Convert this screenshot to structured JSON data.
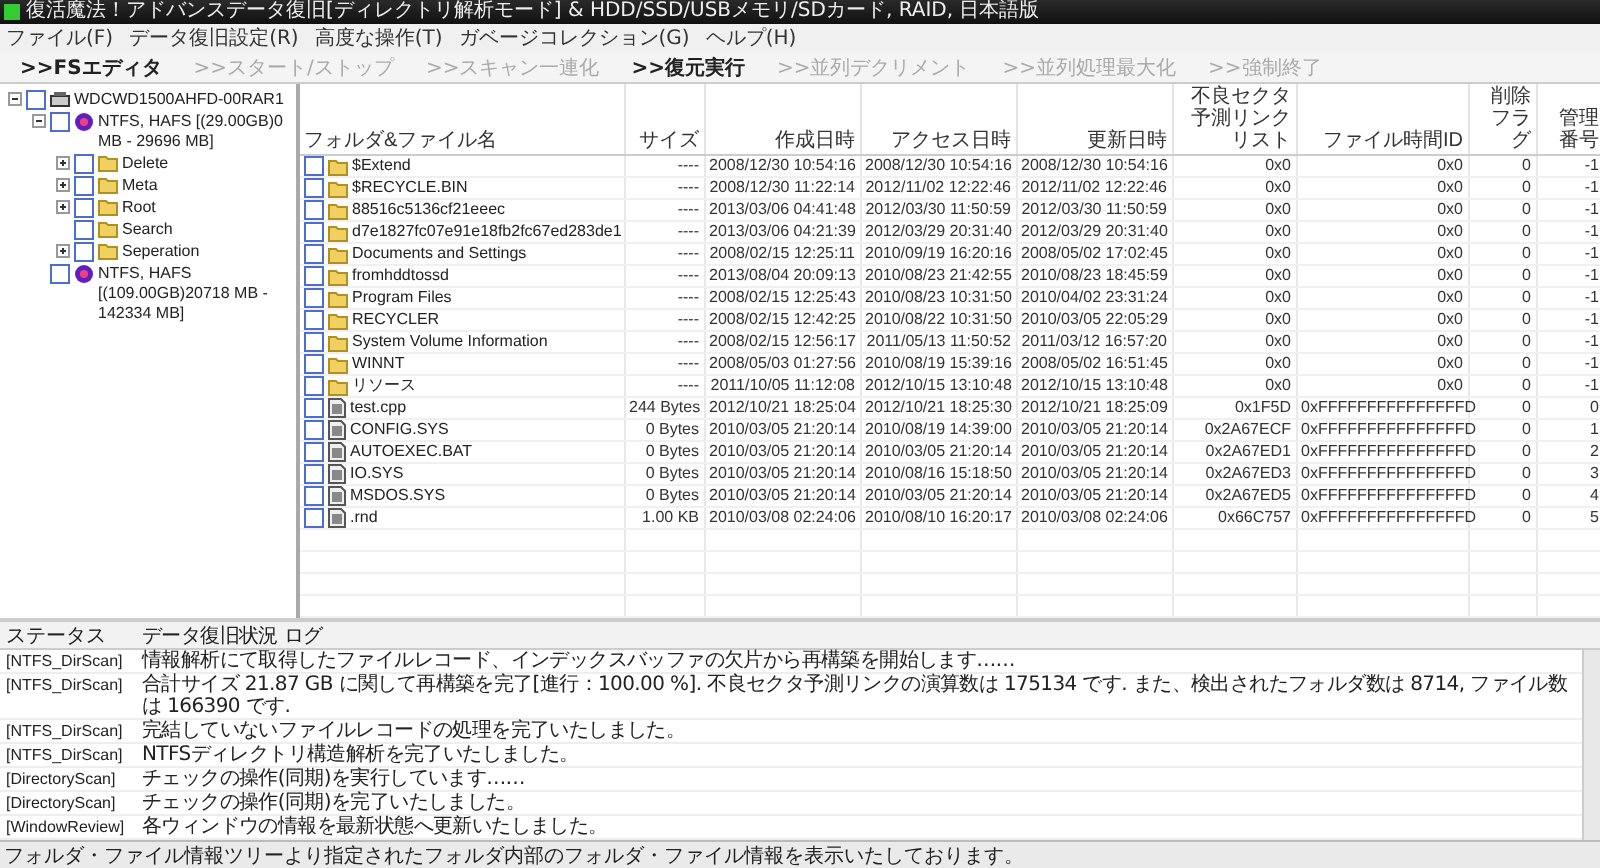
{
  "window": {
    "title": "復活魔法！アドバンスデータ復旧[ディレクトリ解析モード] & HDD/SSD/USBメモリ/SDカード, RAID, 日本語版"
  },
  "menu": [
    "ファイル(F)",
    "データ復旧設定(R)",
    "高度な操作(T)",
    "ガベージコレクション(G)",
    "ヘルプ(H)"
  ],
  "toolbar": [
    {
      "label": ">>FSエディタ",
      "disabled": false
    },
    {
      "label": ">>スタート/ストップ",
      "disabled": true
    },
    {
      "label": ">>スキャン一連化",
      "disabled": true
    },
    {
      "label": ">>復元実行",
      "disabled": false
    },
    {
      "label": ">>並列デクリメント",
      "disabled": true
    },
    {
      "label": ">>並列処理最大化",
      "disabled": true
    },
    {
      "label": ">>強制終了",
      "disabled": true
    }
  ],
  "tree": [
    {
      "label": "WDCWD1500AHFD-00RAR1",
      "kind": "disk",
      "expanded": true,
      "checked": false,
      "children": [
        {
          "label": "NTFS, HAFS [(29.00GB)0 MB - 29696 MB]",
          "kind": "partition",
          "expanded": true,
          "checked": false,
          "children": [
            {
              "label": "Delete",
              "kind": "folder",
              "expanded": false,
              "checked": false
            },
            {
              "label": "Meta",
              "kind": "folder",
              "expanded": false,
              "checked": false
            },
            {
              "label": "Root",
              "kind": "folder",
              "expanded": false,
              "checked": false
            },
            {
              "label": "Search",
              "kind": "folder",
              "checked": false
            },
            {
              "label": "Seperation",
              "kind": "folder",
              "expanded": false,
              "checked": false
            }
          ]
        },
        {
          "label": "NTFS, HAFS [(109.00GB)20718 MB - 142334 MB]",
          "kind": "partition",
          "checked": false
        }
      ]
    }
  ],
  "table": {
    "columns": [
      "フォルダ&ファイル名",
      "サイズ",
      "作成日時",
      "アクセス日時",
      "更新日時",
      "不良セクタ予測リンクリスト",
      "ファイル時間ID",
      "削除フラグ",
      "管理番号"
    ],
    "rows": [
      {
        "kind": "folder",
        "checked": false,
        "cells": [
          "$Extend",
          "----",
          "2008/12/30 10:54:16",
          "2008/12/30 10:54:16",
          "2008/12/30 10:54:16",
          "0x0",
          "0x0",
          "0",
          "-1"
        ]
      },
      {
        "kind": "folder",
        "checked": false,
        "cells": [
          "$RECYCLE.BIN",
          "----",
          "2008/12/30 11:22:14",
          "2012/11/02 12:22:46",
          "2012/11/02 12:22:46",
          "0x0",
          "0x0",
          "0",
          "-1"
        ]
      },
      {
        "kind": "folder",
        "checked": false,
        "cells": [
          "88516c5136cf21eeec",
          "----",
          "2013/03/06 04:41:48",
          "2012/03/30 11:50:59",
          "2012/03/30 11:50:59",
          "0x0",
          "0x0",
          "0",
          "-1"
        ]
      },
      {
        "kind": "folder",
        "checked": false,
        "cells": [
          "d7e1827fc07e91e18fb2fc67ed283de1",
          "----",
          "2013/03/06 04:21:39",
          "2012/03/29 20:31:40",
          "2012/03/29 20:31:40",
          "0x0",
          "0x0",
          "0",
          "-1"
        ]
      },
      {
        "kind": "folder",
        "checked": false,
        "cells": [
          "Documents and Settings",
          "----",
          "2008/02/15 12:25:11",
          "2010/09/19 16:20:16",
          "2008/05/02 17:02:45",
          "0x0",
          "0x0",
          "0",
          "-1"
        ]
      },
      {
        "kind": "folder",
        "checked": false,
        "cells": [
          "fromhddtossd",
          "----",
          "2013/08/04 20:09:13",
          "2010/08/23 21:42:55",
          "2010/08/23 18:45:59",
          "0x0",
          "0x0",
          "0",
          "-1"
        ]
      },
      {
        "kind": "folder",
        "checked": false,
        "cells": [
          "Program Files",
          "----",
          "2008/02/15 12:25:43",
          "2010/08/23 10:31:50",
          "2010/04/02 23:31:24",
          "0x0",
          "0x0",
          "0",
          "-1"
        ]
      },
      {
        "kind": "folder",
        "checked": false,
        "cells": [
          "RECYCLER",
          "----",
          "2008/02/15 12:42:25",
          "2010/08/22 10:31:50",
          "2010/03/05 22:05:29",
          "0x0",
          "0x0",
          "0",
          "-1"
        ]
      },
      {
        "kind": "folder",
        "checked": false,
        "cells": [
          "System Volume Information",
          "----",
          "2008/02/15 12:56:17",
          "2011/05/13 11:50:52",
          "2011/03/12 16:57:20",
          "0x0",
          "0x0",
          "0",
          "-1"
        ]
      },
      {
        "kind": "folder",
        "checked": false,
        "cells": [
          "WINNT",
          "----",
          "2008/05/03 01:27:56",
          "2010/08/19 15:39:16",
          "2008/05/02 16:51:45",
          "0x0",
          "0x0",
          "0",
          "-1"
        ]
      },
      {
        "kind": "folder",
        "checked": false,
        "cells": [
          "リソース",
          "----",
          "2011/10/05 11:12:08",
          "2012/10/15 13:10:48",
          "2012/10/15 13:10:48",
          "0x0",
          "0x0",
          "0",
          "-1"
        ]
      },
      {
        "kind": "file",
        "checked": false,
        "cells": [
          "test.cpp",
          "244 Bytes",
          "2012/10/21 18:25:04",
          "2012/10/21 18:25:30",
          "2012/10/21 18:25:09",
          "0x1F5D",
          "0xFFFFFFFFFFFFFFFD",
          "0",
          "0"
        ]
      },
      {
        "kind": "file",
        "checked": false,
        "cells": [
          "CONFIG.SYS",
          "0 Bytes",
          "2010/03/05 21:20:14",
          "2010/08/19 14:39:00",
          "2010/03/05 21:20:14",
          "0x2A67ECF",
          "0xFFFFFFFFFFFFFFFD",
          "0",
          "1"
        ]
      },
      {
        "kind": "file",
        "checked": false,
        "cells": [
          "AUTOEXEC.BAT",
          "0 Bytes",
          "2010/03/05 21:20:14",
          "2010/03/05 21:20:14",
          "2010/03/05 21:20:14",
          "0x2A67ED1",
          "0xFFFFFFFFFFFFFFFD",
          "0",
          "2"
        ]
      },
      {
        "kind": "file",
        "checked": false,
        "cells": [
          "IO.SYS",
          "0 Bytes",
          "2010/03/05 21:20:14",
          "2010/08/16 15:18:50",
          "2010/03/05 21:20:14",
          "0x2A67ED3",
          "0xFFFFFFFFFFFFFFFD",
          "0",
          "3"
        ]
      },
      {
        "kind": "file",
        "checked": false,
        "cells": [
          "MSDOS.SYS",
          "0 Bytes",
          "2010/03/05 21:20:14",
          "2010/03/05 21:20:14",
          "2010/03/05 21:20:14",
          "0x2A67ED5",
          "0xFFFFFFFFFFFFFFFD",
          "0",
          "4"
        ]
      },
      {
        "kind": "file",
        "checked": false,
        "cells": [
          ".rnd",
          "1.00 KB",
          "2010/03/08 02:24:06",
          "2010/08/10 16:20:17",
          "2010/03/08 02:24:06",
          "0x66C757",
          "0xFFFFFFFFFFFFFFFD",
          "0",
          "5"
        ]
      }
    ]
  },
  "log": {
    "columns": [
      "ステータス",
      "データ復旧状況 ログ"
    ],
    "rows": [
      [
        "[NTFS_DirScan]",
        "情報解析にて取得したファイルレコード、インデックスバッファの欠片から再構築を開始します……"
      ],
      [
        "[NTFS_DirScan]",
        "合計サイズ 21.87 GB に関して再構築を完了[進行：100.00 %]. 不良セクタ予測リンクの演算数は 175134 です. また、検出されたフォルダ数は 8714, ファイル数は 166390 です."
      ],
      [
        "[NTFS_DirScan]",
        "完結していないファイルレコードの処理を完了いたしました。"
      ],
      [
        "[NTFS_DirScan]",
        "NTFSディレクトリ構造解析を完了いたしました。"
      ],
      [
        "[DirectoryScan]",
        "チェックの操作(同期)を実行しています……"
      ],
      [
        "[DirectoryScan]",
        "チェックの操作(同期)を完了いたしました。"
      ],
      [
        "[WindowReview]",
        "各ウィンドウの情報を最新状態へ更新いたしました。"
      ]
    ]
  },
  "status_bar": {
    "label": "フォルダ・ファイル情報",
    "message": "ツリーより指定されたフォルダ内部のフォルダ・ファイル情報を表示いたしております。"
  }
}
